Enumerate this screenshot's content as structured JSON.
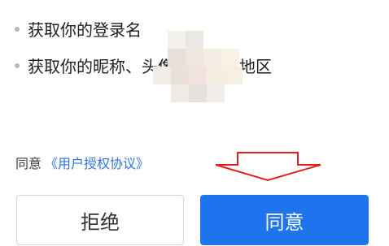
{
  "permissions": [
    {
      "label": "获取你的登录名"
    },
    {
      "label": "获取你的昵称、头像、性别和地区"
    }
  ],
  "agreement": {
    "prefix": "同意",
    "link_text": "《用户授权协议》"
  },
  "buttons": {
    "reject_label": "拒绝",
    "accept_label": "同意"
  },
  "colors": {
    "accent": "#1e73ee",
    "link": "#2f74d8",
    "annotation_arrow": "#e02020"
  }
}
